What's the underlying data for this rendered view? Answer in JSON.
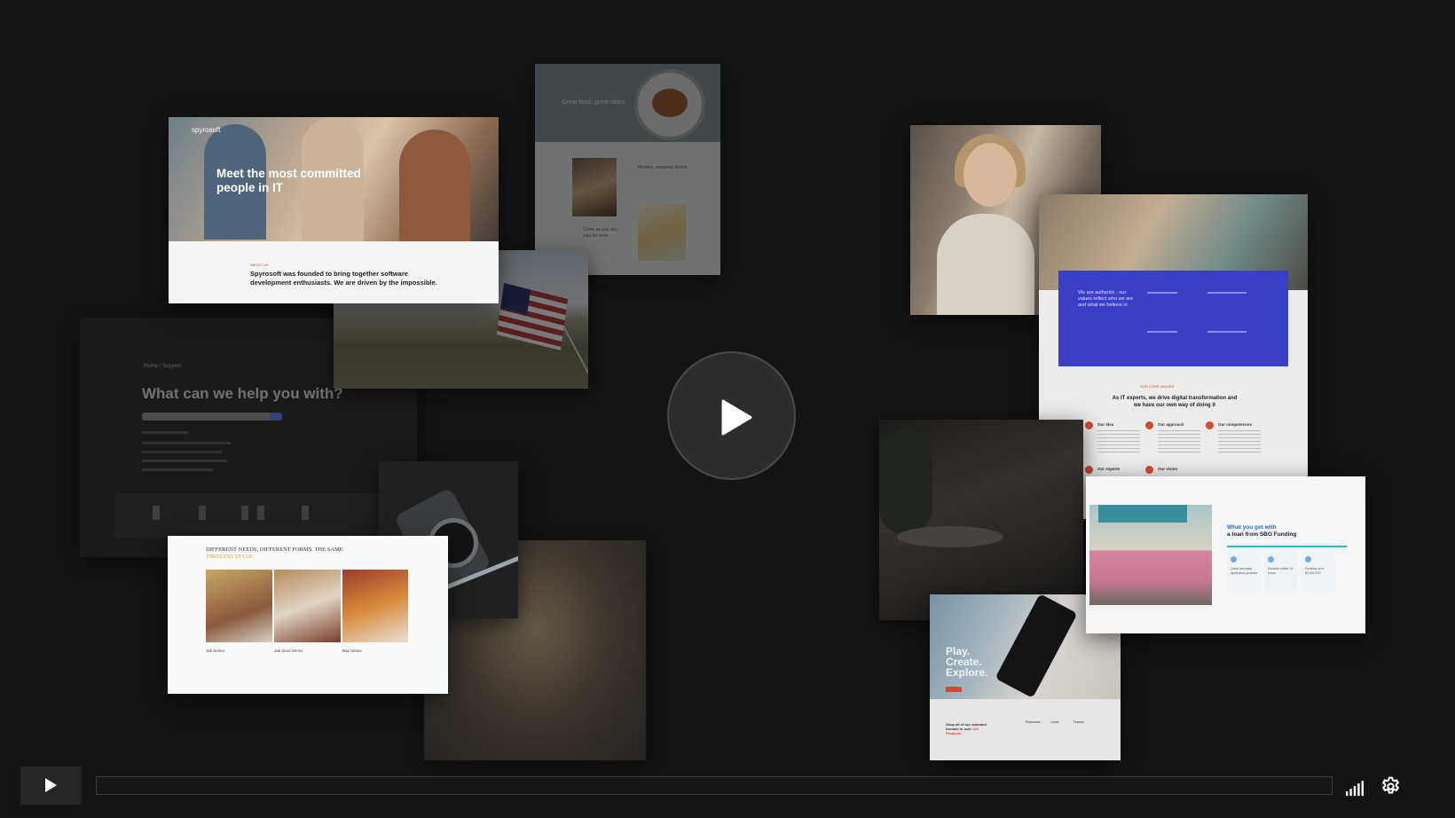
{
  "collage": {
    "spyrosoft": {
      "logo": "spyrosoft",
      "headline": "Meet the most committed people in IT",
      "eyebrow": "ABOUT US",
      "body": "Spyrosoft was founded to bring together software development enthusiasts. We are driven by the impossible."
    },
    "food": {
      "heading": "Great food, great vibes",
      "text_a": "Modern, seasonal dishes",
      "text_b": "Come as you are, stay for more"
    },
    "help": {
      "breadcrumb": "Home  /  Support",
      "question": "What can we help you with?"
    },
    "furniture": {
      "heading_a": "DIFFERENT NEEDS, DIFFERENT FORMS. THE SAME",
      "heading_b": "TIMELESS STYLE.",
      "captions": [
        "Jak Series",
        "Jak Stool Series",
        "Bax Series"
      ]
    },
    "values": {
      "panel_text": "We are authentic - our values reflect who we are and what we believe in",
      "eyebrow": "OUR CORE VALUES",
      "title": "As IT experts, we drive digital transformation and we have our own way of doing it",
      "items": [
        "Our idea",
        "Our approach",
        "Our competences",
        "Our experts",
        "Our vision"
      ]
    },
    "play": {
      "words": [
        "Play.",
        "Create.",
        "Explore."
      ],
      "footer_a": "Shop all of our standard formats in over",
      "footer_b": "120 Products",
      "columns": [
        "Placemats",
        "Loose",
        "Frames"
      ]
    },
    "sbg": {
      "heading_a": "What you get with",
      "heading_b": "a loan from SBG Funding",
      "features": [
        "Quick and easy application process",
        "Decision within 24 hours",
        "Funding up to $2,000,000"
      ]
    }
  },
  "player": {
    "big_play_label": "Play video",
    "play_label": "Play",
    "progress": 0,
    "volume_label": "Volume",
    "settings_label": "Settings"
  },
  "colors": {
    "background": "#141414",
    "control": "#262626",
    "icon": "#ffffff"
  }
}
